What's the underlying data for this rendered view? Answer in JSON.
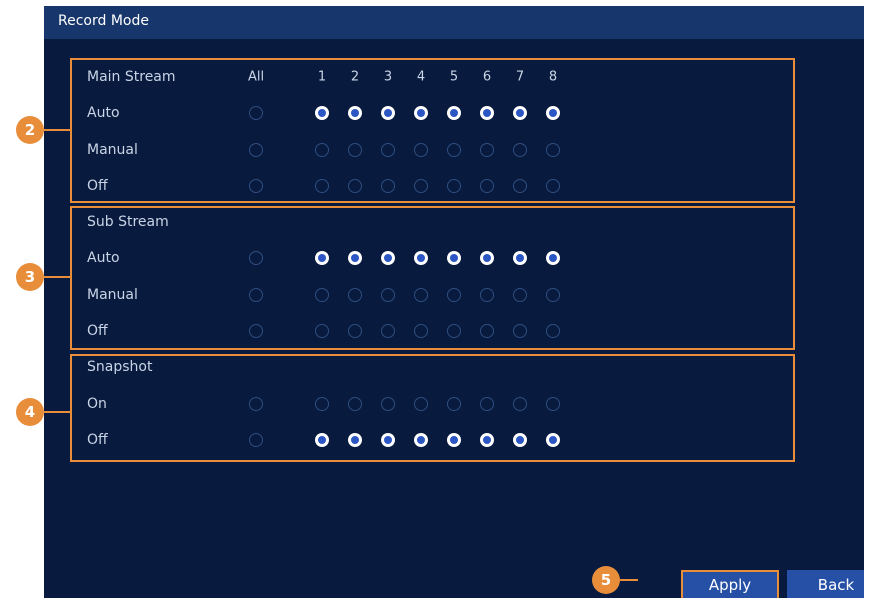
{
  "window": {
    "title": "Record Mode"
  },
  "columns": {
    "all": "All",
    "channels": [
      "1",
      "2",
      "3",
      "4",
      "5",
      "6",
      "7",
      "8"
    ]
  },
  "sections": [
    {
      "id": "main",
      "header": "Main Stream",
      "badge": "2",
      "rows": [
        {
          "label": "Auto",
          "all": false,
          "channels": [
            true,
            true,
            true,
            true,
            true,
            true,
            true,
            true
          ]
        },
        {
          "label": "Manual",
          "all": false,
          "channels": [
            false,
            false,
            false,
            false,
            false,
            false,
            false,
            false
          ]
        },
        {
          "label": "Off",
          "all": false,
          "channels": [
            false,
            false,
            false,
            false,
            false,
            false,
            false,
            false
          ]
        }
      ]
    },
    {
      "id": "sub",
      "header": "Sub Stream",
      "badge": "3",
      "rows": [
        {
          "label": "Auto",
          "all": false,
          "channels": [
            true,
            true,
            true,
            true,
            true,
            true,
            true,
            true
          ]
        },
        {
          "label": "Manual",
          "all": false,
          "channels": [
            false,
            false,
            false,
            false,
            false,
            false,
            false,
            false
          ]
        },
        {
          "label": "Off",
          "all": false,
          "channels": [
            false,
            false,
            false,
            false,
            false,
            false,
            false,
            false
          ]
        }
      ]
    },
    {
      "id": "snap",
      "header": "Snapshot",
      "badge": "4",
      "rows": [
        {
          "label": "On",
          "all": false,
          "channels": [
            false,
            false,
            false,
            false,
            false,
            false,
            false,
            false
          ]
        },
        {
          "label": "Off",
          "all": false,
          "channels": [
            true,
            true,
            true,
            true,
            true,
            true,
            true,
            true
          ]
        }
      ]
    }
  ],
  "buttons": {
    "apply": "Apply",
    "back": "Back",
    "apply_badge": "5"
  },
  "colors": {
    "background": "#081a3d",
    "titlebar": "#17366b",
    "accent": "#e88d3a",
    "button": "#2650a6",
    "radio_checked": "#2c56c4"
  }
}
